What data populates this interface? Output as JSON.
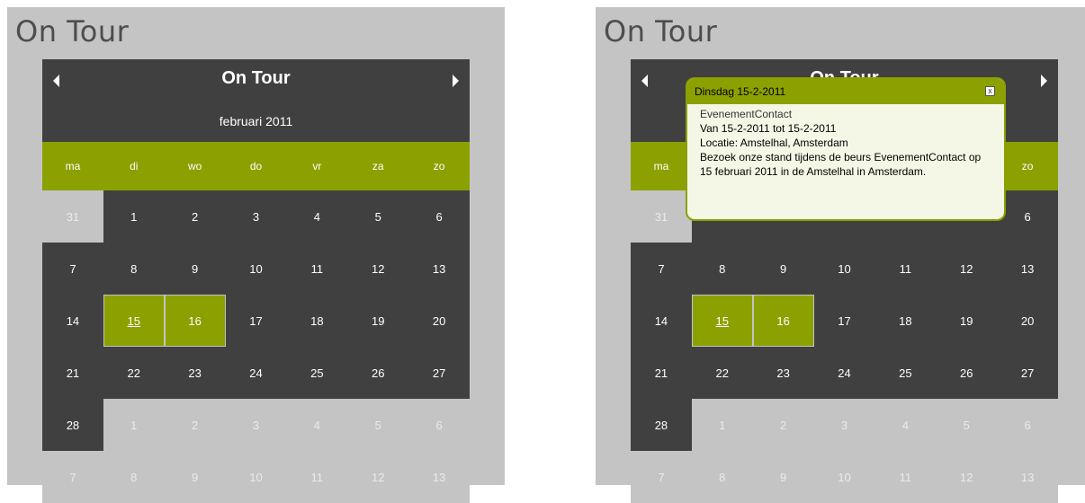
{
  "widget_title": "On Tour",
  "calendar": {
    "header_title": "On Tour",
    "month": "februari 2011",
    "weekdays": [
      "ma",
      "di",
      "wo",
      "do",
      "vr",
      "za",
      "zo"
    ],
    "rows": [
      [
        "31",
        "1",
        "2",
        "3",
        "4",
        "5",
        "6"
      ],
      [
        "7",
        "8",
        "9",
        "10",
        "11",
        "12",
        "13"
      ],
      [
        "14",
        "15",
        "16",
        "17",
        "18",
        "19",
        "20"
      ],
      [
        "21",
        "22",
        "23",
        "24",
        "25",
        "26",
        "27"
      ],
      [
        "28",
        "1",
        "2",
        "3",
        "4",
        "5",
        "6"
      ],
      [
        "7",
        "8",
        "9",
        "10",
        "11",
        "12",
        "13"
      ]
    ],
    "event_days": [
      "15",
      "16"
    ]
  },
  "popup": {
    "date_title": "Dinsdag 15-2-2011",
    "close_symbol": "x",
    "organizer": "EvenementContact",
    "period": "Van 15-2-2011  tot 15-2-2011",
    "location": "Locatie: Amstelhal, Amsterdam",
    "description": "Bezoek onze stand tijdens de beurs EvenementContact op 15 februari 2011 in de Amstelhal in Amsterdam."
  },
  "colors": {
    "accent": "#8ca000",
    "dark": "#404040",
    "panel": "#c4c4c4"
  }
}
